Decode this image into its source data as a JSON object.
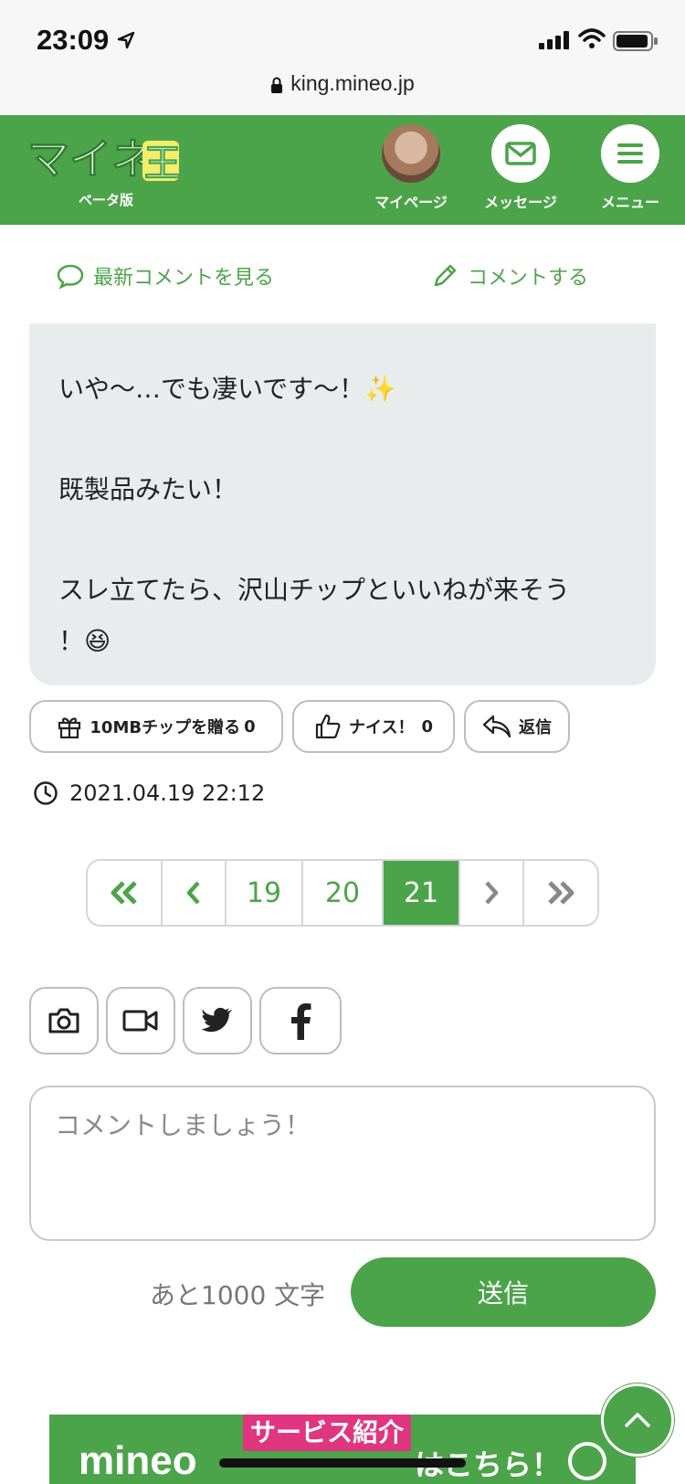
{
  "status_bar": {
    "time": "23:09",
    "url": "king.mineo.jp"
  },
  "header": {
    "logo_text": "マイネ王",
    "logo_sub": "ベータ版",
    "nav": [
      {
        "label": "マイページ",
        "icon": "avatar"
      },
      {
        "label": "メッセージ",
        "icon": "envelope-icon"
      },
      {
        "label": "メニュー",
        "icon": "hamburger-icon"
      }
    ]
  },
  "comment_bar": {
    "latest_label": "最新コメントを見る",
    "write_label": "コメントする"
  },
  "comment": {
    "lines": [
      "いや〜…でも凄いです〜！✨",
      "既製品みたい！",
      "スレ立てたら、沢山チップといいねが来そう",
      "！😆"
    ],
    "chip_label": "10MBチップを贈る",
    "chip_count": "0",
    "nice_label": "ナイス！",
    "nice_count": "0",
    "reply_label": "返信",
    "timestamp": "2021.04.19 22:12"
  },
  "pagination": {
    "pages": [
      "19",
      "20",
      "21"
    ],
    "current": "21"
  },
  "media_buttons": [
    "camera-icon",
    "video-icon",
    "twitter-icon",
    "facebook-icon"
  ],
  "composer": {
    "placeholder": "コメントしましょう！",
    "remaining": "あと1000 文字",
    "send_label": "送信"
  },
  "banner": {
    "brand": "mineo",
    "service": "サービス紹介",
    "here": "はこちら！"
  },
  "colors": {
    "brand_green": "#4ca44a",
    "bubble_bg": "#e9ecec"
  }
}
